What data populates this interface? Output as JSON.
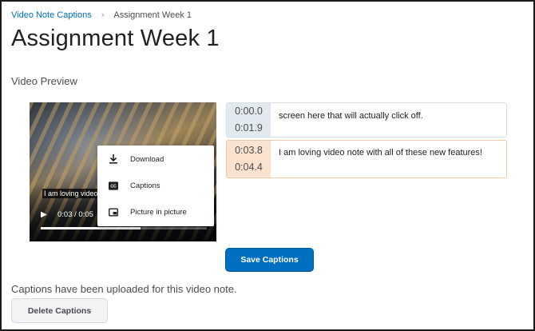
{
  "breadcrumb": {
    "parent": "Video Note Captions",
    "separator": "›",
    "current": "Assignment Week 1"
  },
  "page_title": "Assignment Week 1",
  "section_label": "Video Preview",
  "video": {
    "caption_overlay": "I am loving video",
    "time_display": "0:03 / 0:05",
    "progress_fraction": 0.6,
    "context_menu": [
      {
        "label": "Download",
        "icon": "download-icon"
      },
      {
        "label": "Captions",
        "icon": "captions-icon"
      },
      {
        "label": "Picture in picture",
        "icon": "picture-in-picture-icon"
      }
    ]
  },
  "captions": [
    {
      "start": "0:00.0",
      "end": "0:01.9",
      "text": "screen here that will actually click off."
    },
    {
      "start": "0:03.8",
      "end": "0:04.4",
      "text": "I am loving video note with all of these new features!"
    }
  ],
  "save_button": "Save Captions",
  "status_text": "Captions have been uploaded for this video note.",
  "delete_button": "Delete Captions",
  "colors": {
    "primary": "#006fbf",
    "link": "#006fbf",
    "caption_row_1_accent": "#e3e9f1",
    "caption_row_2_accent": "#fbe2cf"
  }
}
